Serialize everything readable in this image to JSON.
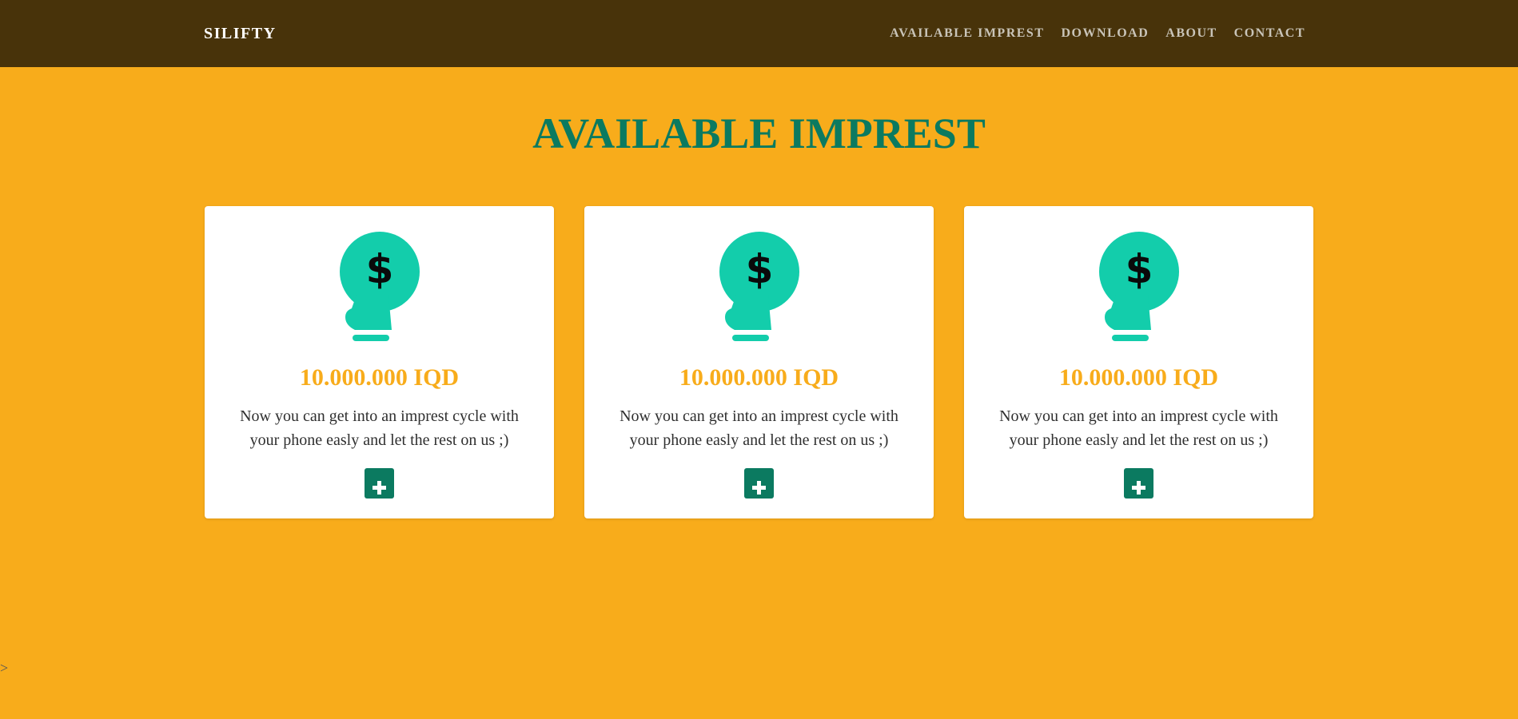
{
  "navbar": {
    "brand": "SILIFTY",
    "links": [
      "AVAILABLE IMPREST",
      "DOWNLOAD",
      "ABOUT",
      "CONTACT"
    ]
  },
  "main": {
    "title": "AVAILABLE IMPREST",
    "cards": [
      {
        "icon": "idea-dollar-icon",
        "amount": "10.000.000 IQD",
        "description": "Now you can get into an imprest cycle with your phone easly and let the rest on us ;)",
        "button_icon": "plus-icon"
      },
      {
        "icon": "idea-dollar-icon",
        "amount": "10.000.000 IQD",
        "description": "Now you can get into an imprest cycle with your phone easly and let the rest on us ;)",
        "button_icon": "plus-icon"
      },
      {
        "icon": "idea-dollar-icon",
        "amount": "10.000.000 IQD",
        "description": "Now you can get into an imprest cycle with your phone easly and let the rest on us ;)",
        "button_icon": "plus-icon"
      }
    ]
  },
  "stray_text": ">",
  "colors": {
    "page_background": "#f8ac1b",
    "navbar_background": "#48330a",
    "title": "#0b7a60",
    "icon": "#13cdab",
    "amount": "#f8ac1b",
    "button": "#0b7a60"
  }
}
